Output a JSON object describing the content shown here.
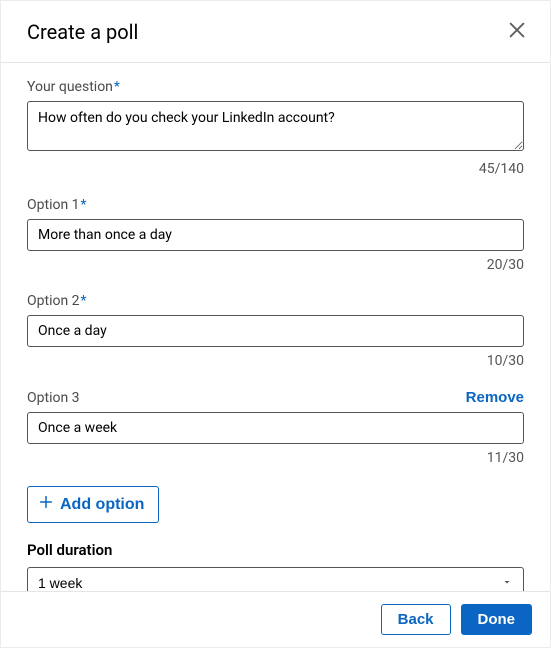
{
  "header": {
    "title": "Create a poll"
  },
  "question": {
    "label": "Your question",
    "required_marker": "*",
    "value": "How often do you check your LinkedIn account?",
    "counter": "45/140"
  },
  "options": [
    {
      "label": "Option 1",
      "required_marker": "*",
      "value": "More than once a day",
      "counter": "20/30",
      "removable": false
    },
    {
      "label": "Option 2",
      "required_marker": "*",
      "value": "Once a day",
      "counter": "10/30",
      "removable": false
    },
    {
      "label": "Option 3",
      "required_marker": "",
      "value": "Once a week",
      "counter": "11/30",
      "removable": true
    }
  ],
  "remove_label": "Remove",
  "add_option_label": "Add option",
  "duration": {
    "label": "Poll duration",
    "selected": "1 week"
  },
  "footer": {
    "back": "Back",
    "done": "Done"
  }
}
